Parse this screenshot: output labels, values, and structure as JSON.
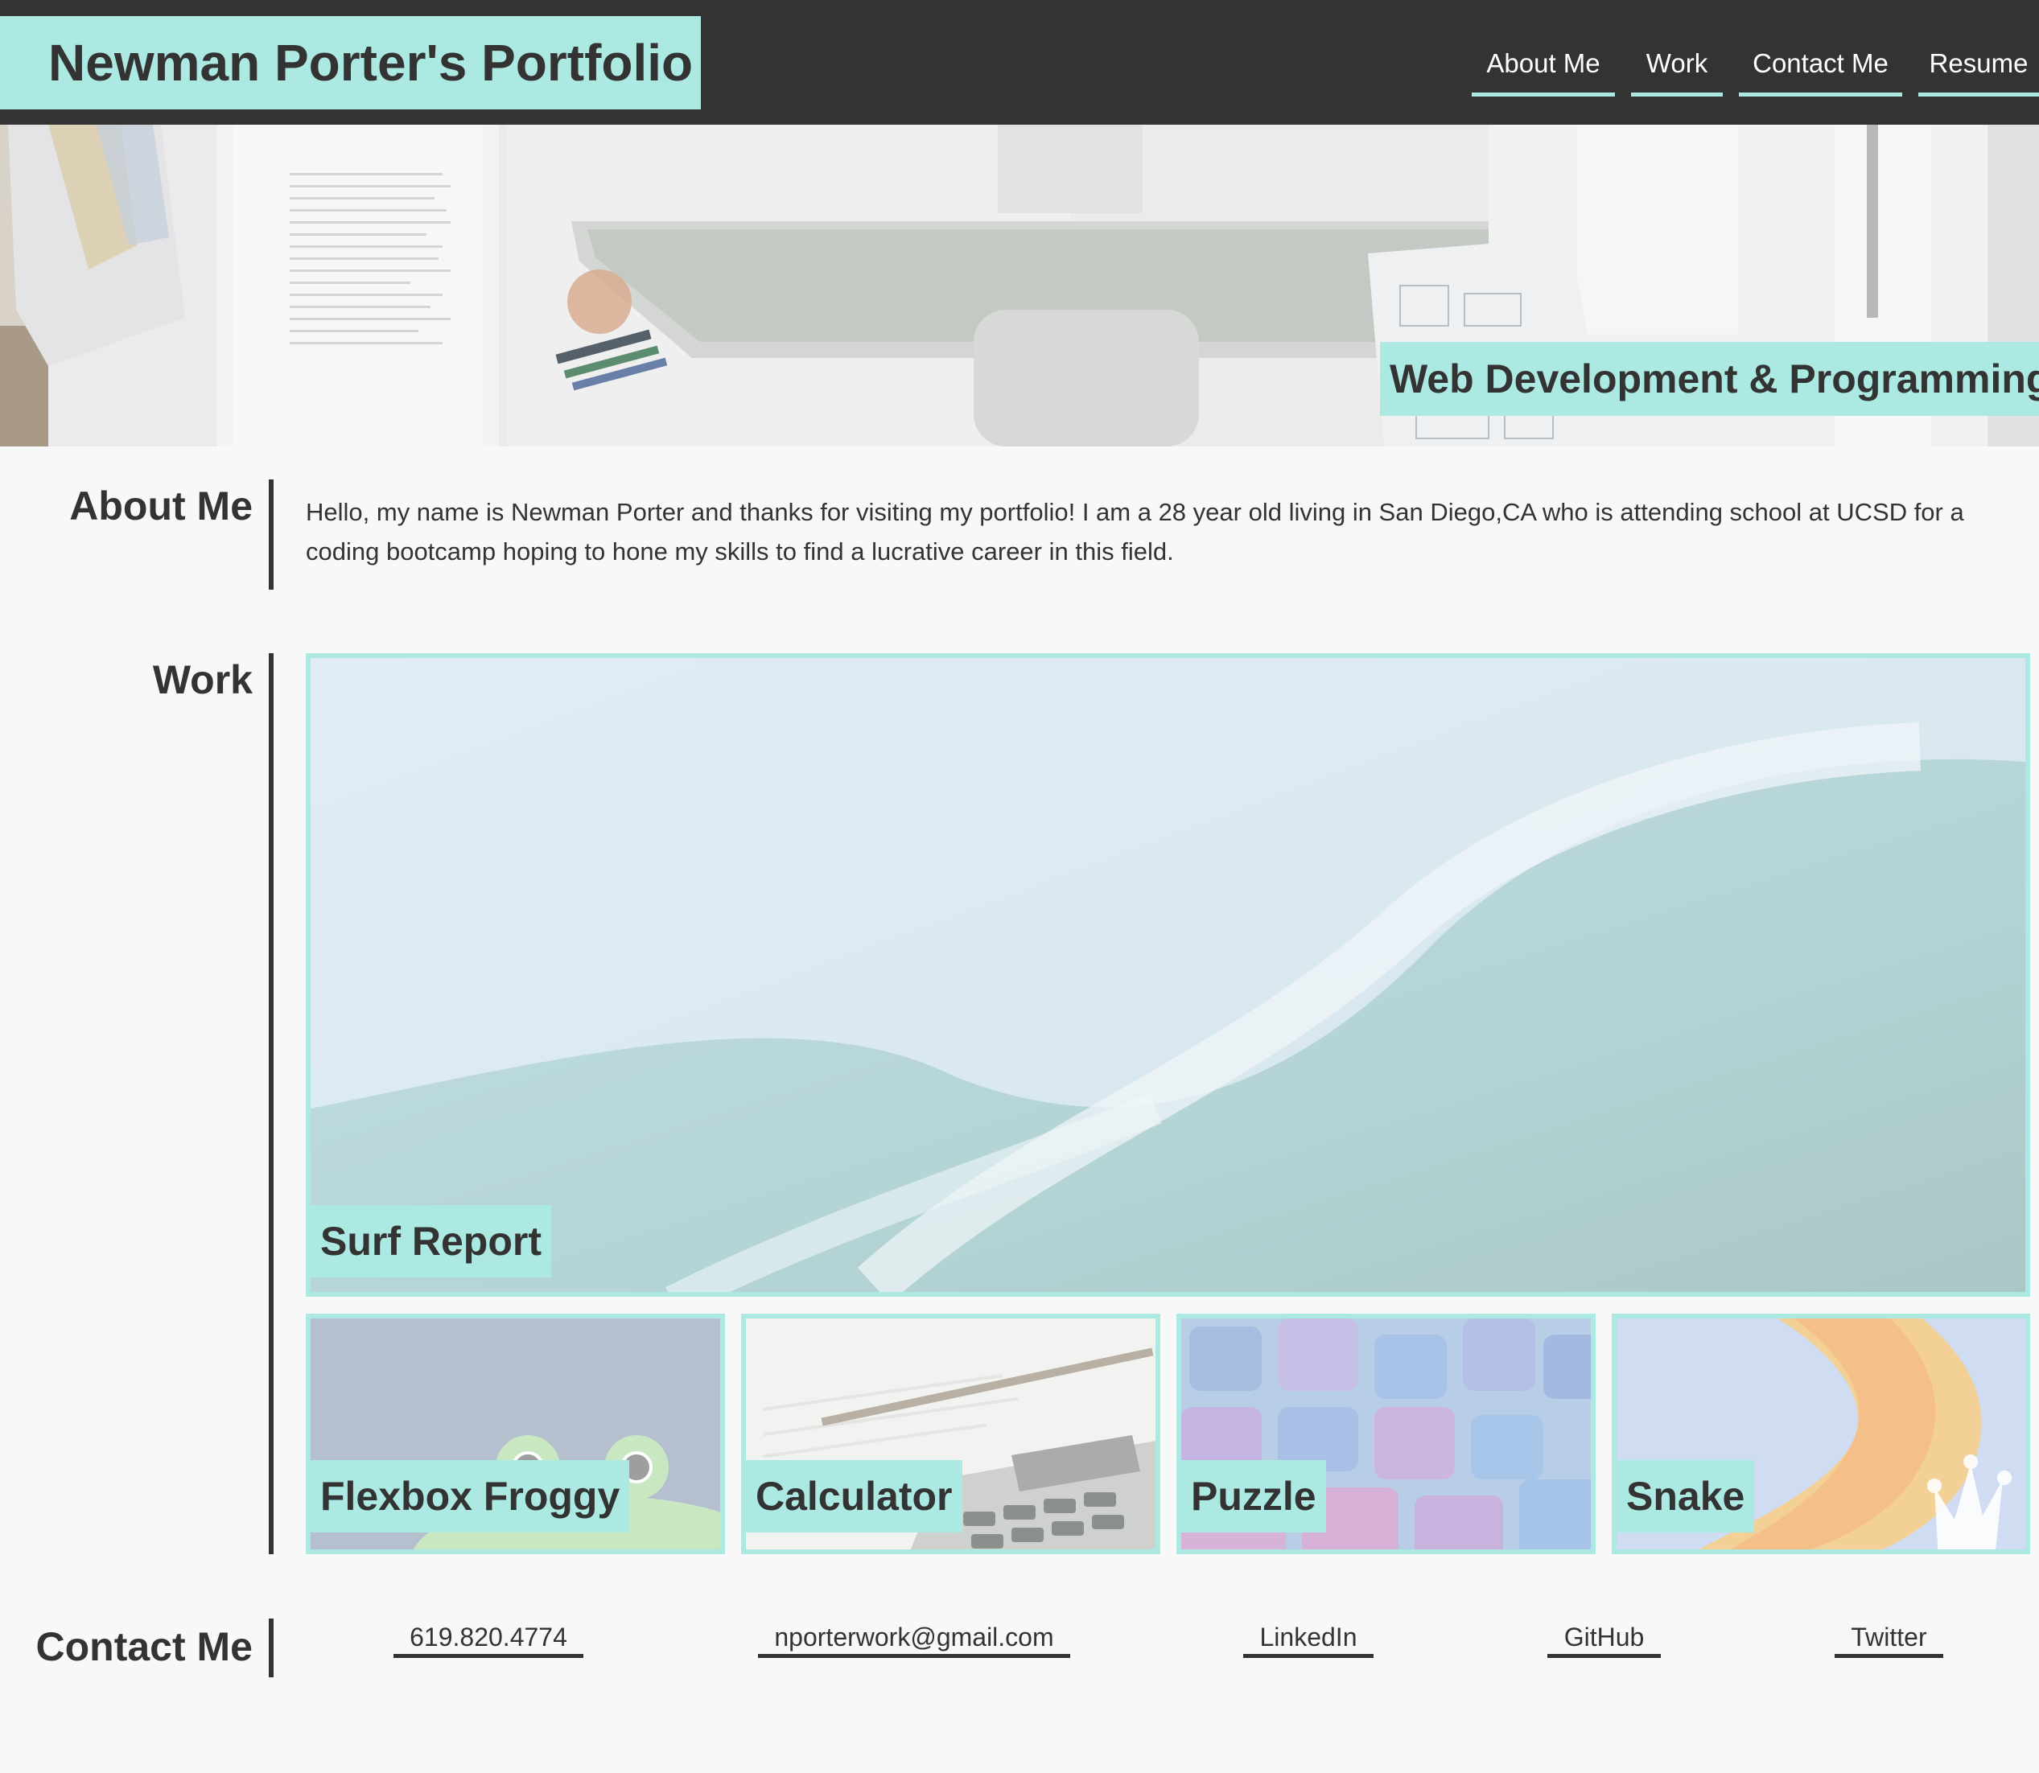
{
  "header": {
    "title": "Newman Porter's Portfolio",
    "nav": [
      {
        "label": "About Me"
      },
      {
        "label": "Work"
      },
      {
        "label": "Contact Me"
      },
      {
        "label": "Resume"
      }
    ]
  },
  "hero": {
    "tagline": "Web Development & Programming"
  },
  "about": {
    "heading": "About Me",
    "text": "Hello, my name is Newman Porter and thanks for visiting my portfolio! I am a 28 year old living in San Diego,CA who is attending school at UCSD for a coding bootcamp hoping to hone my skills to find a lucrative career in this field."
  },
  "work": {
    "heading": "Work",
    "featured": {
      "label": "Surf Report"
    },
    "projects": [
      {
        "label": "Flexbox Froggy"
      },
      {
        "label": "Calculator"
      },
      {
        "label": "Puzzle"
      },
      {
        "label": "Snake"
      }
    ]
  },
  "contact": {
    "heading": "Contact Me",
    "links": [
      {
        "label": "619.820.4774"
      },
      {
        "label": "nporterwork@gmail.com"
      },
      {
        "label": "LinkedIn"
      },
      {
        "label": "GitHub"
      },
      {
        "label": "Twitter"
      }
    ]
  },
  "colors": {
    "accent": "#abe9e2",
    "dark": "#333333",
    "background": "#f8f8f8"
  }
}
